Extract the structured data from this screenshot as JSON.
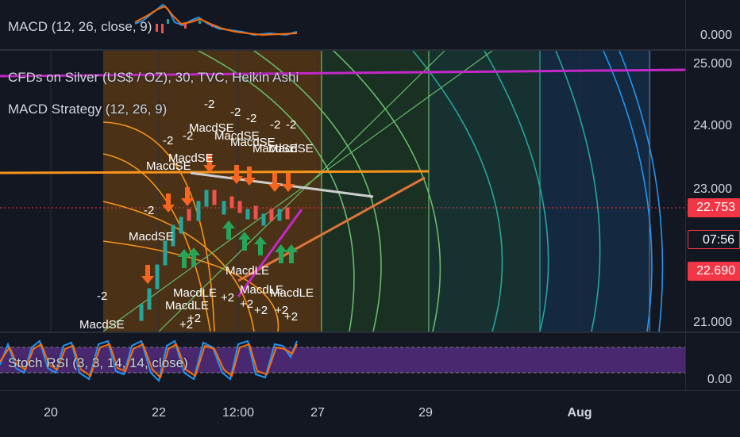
{
  "macd_pane": {
    "legend": "MACD (12, 26, close, 9)",
    "axis_tick": "0.000"
  },
  "main_pane": {
    "symbol_legend": "CFDs on Silver (US$ / OZ), 30, TVC, Heikin Ashi",
    "strategy_legend": "MACD Strategy (12, 26, 9)",
    "axis_ticks": [
      "25.000",
      "24.000",
      "23.000",
      "21.000"
    ],
    "price_badge": "22.753",
    "countdown_badge": "07:56",
    "low_badge": "22.690",
    "colors": {
      "price_badge": "#f23645",
      "countdown_badge": "#f23645",
      "low_badge": "#f23645",
      "magenta_line": "#c428c8",
      "orange": "#f7931a",
      "long_arrow": "#26a65b",
      "short_arrow": "#f7661e"
    },
    "signal_labels": {
      "short_entry": "MacdSE",
      "long_entry": "MacdLE",
      "short_qty": "-2",
      "long_qty": "+2"
    }
  },
  "stoch_pane": {
    "legend": "Stoch RSI (3, 3, 14, 14, close)",
    "axis_tick": "0.00"
  },
  "time_axis": {
    "labels": [
      "20",
      "22",
      "12:00",
      "27",
      "29",
      "Aug"
    ]
  }
}
